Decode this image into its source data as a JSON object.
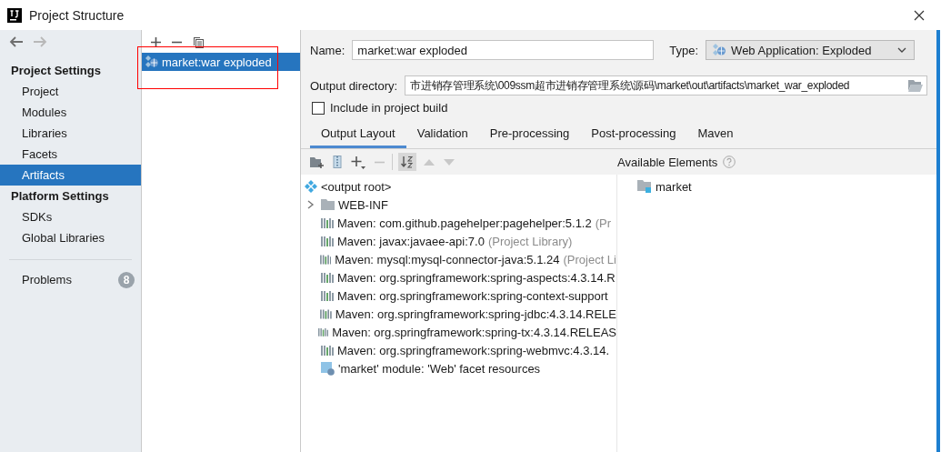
{
  "window": {
    "title": "Project Structure"
  },
  "sidebar": {
    "sections": [
      {
        "title": "Project Settings",
        "items": [
          {
            "label": "Project",
            "selected": false
          },
          {
            "label": "Modules",
            "selected": false
          },
          {
            "label": "Libraries",
            "selected": false
          },
          {
            "label": "Facets",
            "selected": false
          },
          {
            "label": "Artifacts",
            "selected": true
          }
        ]
      },
      {
        "title": "Platform Settings",
        "items": [
          {
            "label": "SDKs",
            "selected": false
          },
          {
            "label": "Global Libraries",
            "selected": false
          }
        ]
      }
    ],
    "problems": {
      "label": "Problems",
      "count": "8"
    }
  },
  "artifacts": {
    "items": [
      {
        "label": "market:war exploded",
        "selected": true
      }
    ]
  },
  "editor": {
    "name_label": "Name:",
    "name_value": "market:war exploded",
    "type_label": "Type:",
    "type_value": "Web Application: Exploded",
    "output_label": "Output directory:",
    "output_value": "市进销存管理系统\\009ssm超市进销存管理系统\\源码\\market\\out\\artifacts\\market_war_exploded",
    "include": {
      "label": "Include in project build",
      "checked": false
    },
    "tabs": [
      {
        "label": "Output Layout",
        "selected": true
      },
      {
        "label": "Validation",
        "selected": false
      },
      {
        "label": "Pre-processing",
        "selected": false
      },
      {
        "label": "Post-processing",
        "selected": false
      },
      {
        "label": "Maven",
        "selected": false
      }
    ],
    "available_label": "Available Elements",
    "layout_tree": [
      {
        "kind": "root",
        "label": "<output root>"
      },
      {
        "kind": "folder",
        "label": "WEB-INF",
        "expanded": false
      },
      {
        "kind": "library",
        "label": "Maven: com.github.pagehelper:pagehelper:5.1.2",
        "detail": "(Pr"
      },
      {
        "kind": "library",
        "label": "Maven: javax:javaee-api:7.0",
        "detail": "(Project Library)"
      },
      {
        "kind": "library",
        "label": "Maven: mysql:mysql-connector-java:5.1.24",
        "detail": "(Project Li"
      },
      {
        "kind": "library",
        "label": "Maven: org.springframework:spring-aspects:4.3.14.R"
      },
      {
        "kind": "library",
        "label": "Maven: org.springframework:spring-context-support"
      },
      {
        "kind": "library",
        "label": "Maven: org.springframework:spring-jdbc:4.3.14.RELE"
      },
      {
        "kind": "library",
        "label": "Maven: org.springframework:spring-tx:4.3.14.RELEAS"
      },
      {
        "kind": "library",
        "label": "Maven: org.springframework:spring-webmvc:4.3.14."
      },
      {
        "kind": "facet",
        "label": "'market' module: 'Web' facet resources"
      }
    ],
    "available_tree": [
      {
        "kind": "module",
        "label": "market"
      }
    ]
  }
}
